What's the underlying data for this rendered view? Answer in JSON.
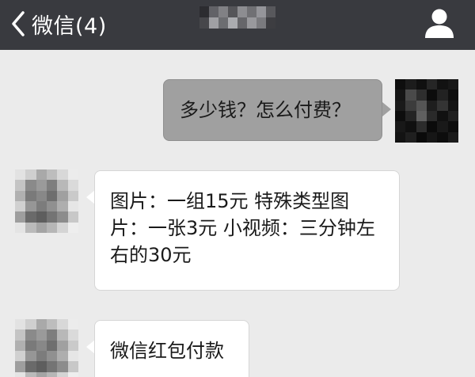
{
  "header": {
    "back_label": "微信(4)",
    "back_icon": "chevron-left-icon",
    "contact_name_obscured": true,
    "profile_icon": "person-icon",
    "background": "#393a3f"
  },
  "messages": [
    {
      "side": "outgoing",
      "text": "多少钱？怎么付费？"
    },
    {
      "side": "incoming",
      "text": "图片：一组15元 特殊类型图片：一张3元 小视频：三分钟左右的30元"
    },
    {
      "side": "incoming",
      "text": "微信红包付款"
    }
  ],
  "colors": {
    "chat_background": "#ebebeb",
    "outgoing_bubble": "#a0a0a0",
    "incoming_bubble": "#ffffff"
  }
}
